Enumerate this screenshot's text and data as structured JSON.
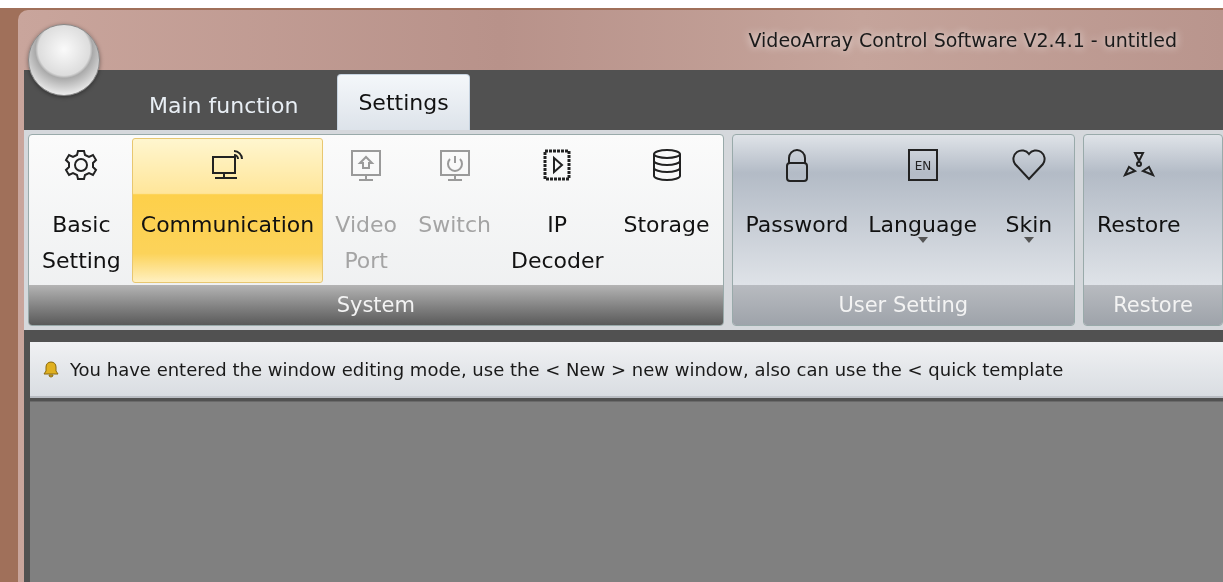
{
  "window": {
    "title": "VideoArray Control Software V2.4.1 - untitled"
  },
  "tabs": [
    {
      "label": "Main function",
      "selected": false
    },
    {
      "label": "Settings",
      "selected": true
    }
  ],
  "ribbon": {
    "groups": [
      {
        "title": "System",
        "items": [
          {
            "kind": "gear",
            "lines": [
              "Basic",
              "Setting"
            ],
            "selected": false,
            "disabled": false,
            "dropdown": false
          },
          {
            "kind": "monitor-wireless",
            "lines": [
              "Communication"
            ],
            "selected": true,
            "disabled": false,
            "dropdown": false
          },
          {
            "kind": "monitor-upload",
            "lines": [
              "Video",
              "Port"
            ],
            "selected": false,
            "disabled": true,
            "dropdown": false
          },
          {
            "kind": "monitor-power",
            "lines": [
              "Switch"
            ],
            "selected": false,
            "disabled": true,
            "dropdown": false
          },
          {
            "kind": "chip",
            "lines": [
              "IP",
              "Decoder"
            ],
            "selected": false,
            "disabled": false,
            "dropdown": false
          },
          {
            "kind": "database",
            "lines": [
              "Storage"
            ],
            "selected": false,
            "disabled": false,
            "dropdown": false
          }
        ]
      },
      {
        "title": "User Setting",
        "items": [
          {
            "kind": "lock",
            "lines": [
              "Password"
            ],
            "selected": false,
            "disabled": false,
            "dropdown": false
          },
          {
            "kind": "language",
            "badge": "EN",
            "lines": [
              "Language"
            ],
            "selected": false,
            "disabled": false,
            "dropdown": true
          },
          {
            "kind": "heart",
            "lines": [
              "Skin"
            ],
            "selected": false,
            "disabled": false,
            "dropdown": true
          }
        ]
      },
      {
        "title": "Restore",
        "items": [
          {
            "kind": "trefoil",
            "lines": [
              "Restore"
            ],
            "selected": false,
            "disabled": false,
            "dropdown": false
          }
        ]
      }
    ]
  },
  "notice": {
    "text": "You have entered the window editing mode, use the < New > new window, also can use the < quick template"
  }
}
